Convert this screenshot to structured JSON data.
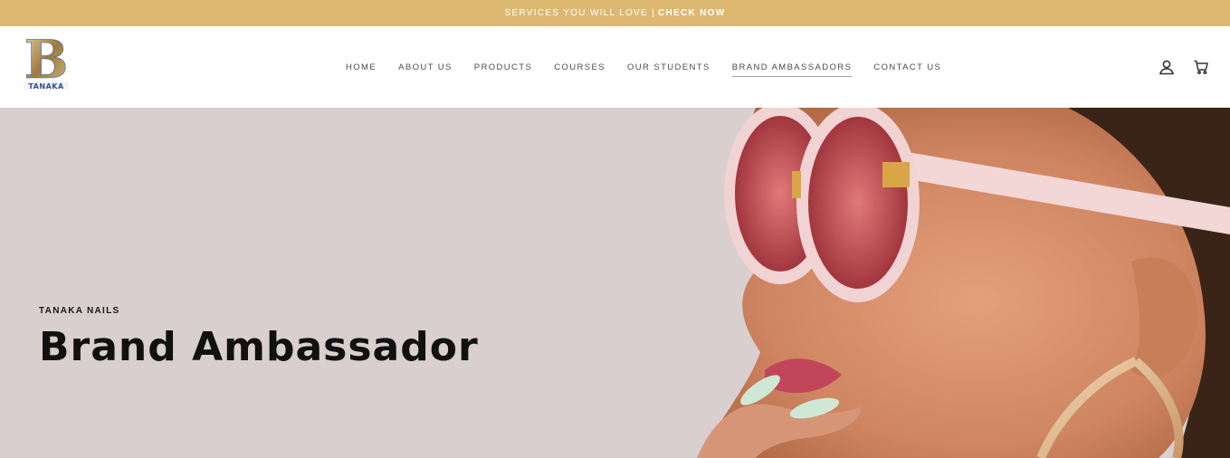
{
  "announcement": {
    "text": "SERVICES YOU WILL LOVE |",
    "link": "CHECK NOW"
  },
  "header": {
    "logo_letter": "B",
    "logo_text": "TANAKA",
    "nav": [
      {
        "label": "HOME"
      },
      {
        "label": "ABOUT US"
      },
      {
        "label": "PRODUCTS"
      },
      {
        "label": "COURSES"
      },
      {
        "label": "OUR STUDENTS"
      },
      {
        "label": "BRAND AMBASSADORS",
        "active": true
      },
      {
        "label": "CONTACT US"
      }
    ],
    "icons": {
      "account": "account-icon",
      "cart": "cart-icon"
    }
  },
  "hero": {
    "eyebrow": "TANAKA NAILS",
    "title": "Brand Ambassador"
  },
  "colors": {
    "announcement_bg": "#dcb870",
    "hero_bg": "#d9cfcf",
    "nav_text": "#4a4a4a",
    "title_text": "#111111"
  }
}
